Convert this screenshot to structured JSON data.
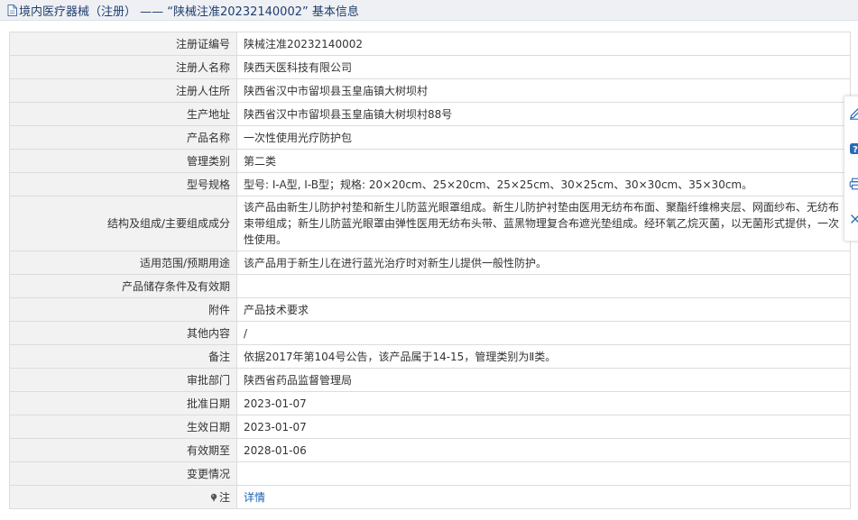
{
  "header": {
    "title": "境内医疗器械（注册） —— “陕械注准20232140002” 基本信息",
    "icon": "document-icon"
  },
  "rows": [
    {
      "label": "注册证编号",
      "value": "陕械注准20232140002"
    },
    {
      "label": "注册人名称",
      "value": "陕西天医科技有限公司"
    },
    {
      "label": "注册人住所",
      "value": "陕西省汉中市留坝县玉皇庙镇大树坝村"
    },
    {
      "label": "生产地址",
      "value": "陕西省汉中市留坝县玉皇庙镇大树坝村88号"
    },
    {
      "label": "产品名称",
      "value": "一次性使用光疗防护包"
    },
    {
      "label": "管理类别",
      "value": "第二类"
    },
    {
      "label": "型号规格",
      "value": "型号: Ⅰ-A型, Ⅰ-B型；规格: 20×20cm、25×20cm、25×25cm、30×25cm、30×30cm、35×30cm。"
    },
    {
      "label": "结构及组成/主要组成成分",
      "value": "该产品由新生儿防护衬垫和新生儿防蓝光眼罩组成。新生儿防护衬垫由医用无纺布布面、聚酯纤维棉夹层、网面纱布、无纺布束带组成；新生儿防蓝光眼罩由弹性医用无纺布头带、蓝黑物理复合布遮光垫组成。经环氧乙烷灭菌，以无菌形式提供，一次性使用。"
    },
    {
      "label": "适用范围/预期用途",
      "value": "该产品用于新生儿在进行蓝光治疗时对新生儿提供一般性防护。"
    },
    {
      "label": "产品储存条件及有效期",
      "value": ""
    },
    {
      "label": "附件",
      "value": "产品技术要求"
    },
    {
      "label": "其他内容",
      "value": "/"
    },
    {
      "label": "备注",
      "value": "依据2017年第104号公告，该产品属于14-15，管理类别为Ⅱ类。"
    },
    {
      "label": "审批部门",
      "value": "陕西省药品监督管理局"
    },
    {
      "label": "批准日期",
      "value": "2023-01-07"
    },
    {
      "label": "生效日期",
      "value": "2023-01-07"
    },
    {
      "label": "有效期至",
      "value": "2028-01-06"
    },
    {
      "label": "变更情况",
      "value": ""
    }
  ],
  "note_row": {
    "icon": "pin-icon",
    "label": "注",
    "link_text": "详情"
  },
  "side_toolbar": {
    "tools": [
      "edit-icon",
      "help-icon",
      "print-icon",
      "close-icon"
    ]
  },
  "colors": {
    "header_bg": "#eef0f4",
    "header_text": "#1f3e6e",
    "label_bg": "#f2f2f2",
    "border": "#dcdcdc",
    "link": "#1a5fb4",
    "accent": "#2a6ab8"
  }
}
